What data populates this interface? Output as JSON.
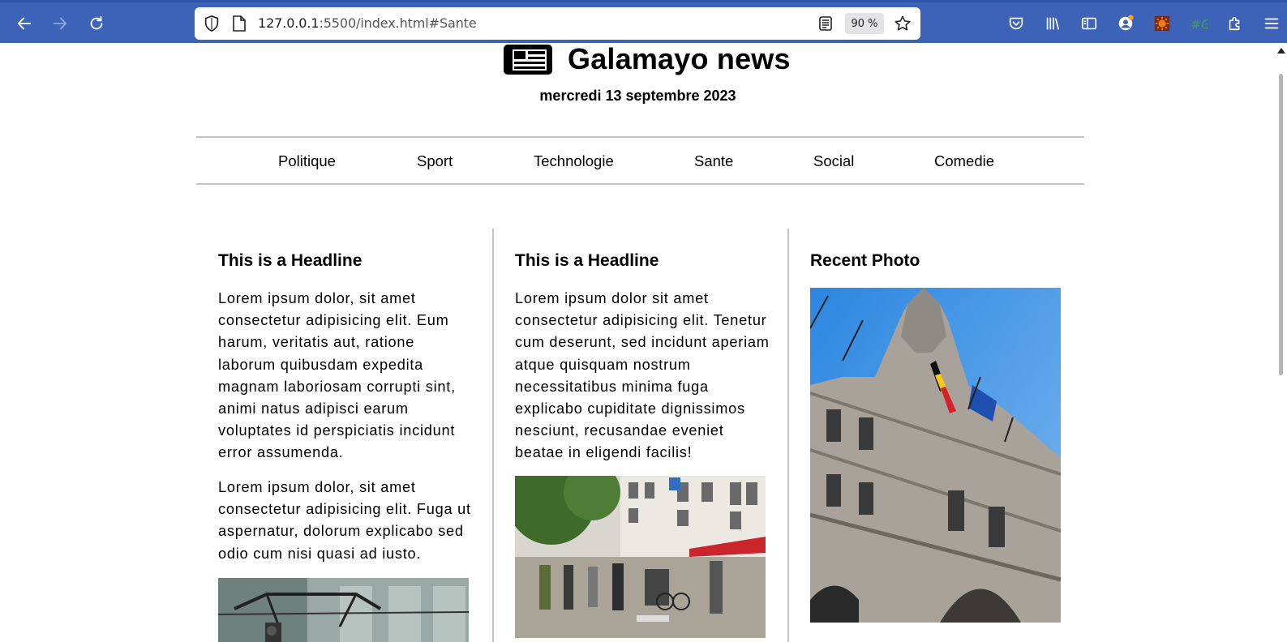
{
  "browser": {
    "url_host": "127.0.0.1",
    "url_rest": ":5500/index.html#Sante",
    "zoom": "90 %"
  },
  "site": {
    "title": "Galamayo news",
    "date": "mercredi 13 septembre 2023"
  },
  "nav": [
    "Politique",
    "Sport",
    "Technologie",
    "Sante",
    "Social",
    "Comedie"
  ],
  "columns": [
    {
      "headline": "This is a Headline",
      "paragraphs": [
        "Lorem ipsum dolor, sit amet consectetur adipisicing elit. Eum harum, veritatis aut, ratione laborum quibusdam expedita magnam laboriosam corrupti sint, animi natus adipisci earum voluptates id perspiciatis incidunt error assumenda.",
        "Lorem ipsum dolor, sit amet consectetur adipisicing elit. Fuga ut aspernatur, dolorum explicabo sed odio cum nisi quasi ad iusto."
      ]
    },
    {
      "headline": "This is a Headline",
      "paragraphs": [
        "Lorem ipsum dolor sit amet consectetur adipisicing elit. Tenetur cum deserunt, sed incidunt aperiam atque quisquam nostrum necessitatibus minima fuga explicabo cupiditate dignissimos nesciunt, recusandae eveniet beatae in eligendi facilis!"
      ]
    },
    {
      "headline": "Recent Photo"
    }
  ],
  "icons": {
    "back": "arrow-left-icon",
    "forward": "arrow-right-icon",
    "reload": "reload-icon",
    "shield": "shield-icon",
    "page": "page-icon",
    "reader": "reader-view-icon",
    "star": "bookmark-star-icon",
    "logo": "newspaper-icon"
  },
  "colors": {
    "chrome": "#3c63b8",
    "divider": "#c4c4c4",
    "text": "#000000"
  }
}
